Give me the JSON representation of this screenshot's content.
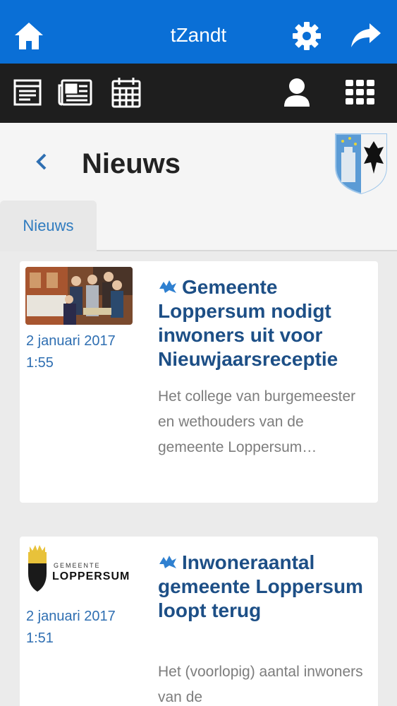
{
  "header": {
    "title": "tZandt",
    "home_icon": "home-icon",
    "settings_icon": "gear-icon",
    "share_icon": "share-arrow-icon",
    "color": "#0a6fd6"
  },
  "toolbar": {
    "items": [
      "news-list-icon",
      "newspaper-icon",
      "calendar-icon",
      "user-icon",
      "grid-menu-icon"
    ]
  },
  "page": {
    "title": "Nieuws",
    "back_icon": "chevron-left-icon"
  },
  "tabs": [
    {
      "label": "Nieuws",
      "active": true
    }
  ],
  "articles": [
    {
      "date": "2 januari 2017",
      "time": "1:55",
      "title": "Gemeente Loppersum nodigt inwoners uit voor Nieuwjaarsreceptie",
      "excerpt": "Het college van burgemeester en wethouders van de gemeente Loppersum…"
    },
    {
      "date": "2 januari 2017",
      "time": "1:51",
      "title": "Inwoneraantal gemeente Loppersum loopt terug",
      "excerpt": "Het (voorlopig) aantal inwoners van de",
      "logo_text_small": "GEMEENTE",
      "logo_text_large": "LOPPERSUM"
    }
  ]
}
